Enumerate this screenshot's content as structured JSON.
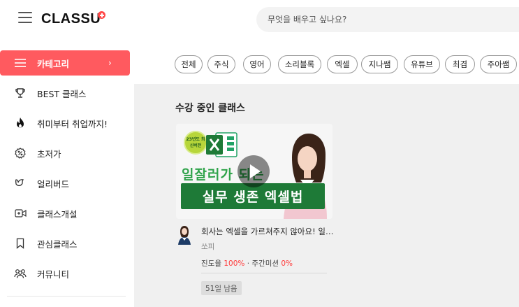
{
  "header": {
    "logo_text": "CLASSU",
    "search_placeholder": "무엇을 배우고 싶나요?"
  },
  "sidebar": {
    "items": [
      {
        "label": "카테고리",
        "icon": "menu-icon",
        "active": true
      },
      {
        "label": "BEST 클래스",
        "icon": "trophy-icon"
      },
      {
        "label": "취미부터 취업까지!",
        "icon": "fire-icon"
      },
      {
        "label": "초저가",
        "icon": "discount-badge-icon"
      },
      {
        "label": "얼리버드",
        "icon": "bird-icon"
      },
      {
        "label": "클래스개설",
        "icon": "video-plus-icon"
      },
      {
        "label": "관심클래스",
        "icon": "bookmark-icon"
      },
      {
        "label": "커뮤니티",
        "icon": "community-icon"
      }
    ]
  },
  "chips": [
    "전체",
    "주식",
    "영어",
    "소리블록",
    "엑셀",
    "지나쌤",
    "유튜브",
    "최겸",
    "주아쌤"
  ],
  "main": {
    "section_title": "수강 중인 클래스",
    "card": {
      "badge_text": "23년도 최신버전",
      "thumb_subtitle": "일잘러가 되는",
      "thumb_title": "실무 생존 엑셀법",
      "title": "회사는 엑셀을 가르쳐주지 않아요! 일잘러가 되는 실무 생존 엑셀법",
      "instructor": "쏘피",
      "progress_label": "진도율",
      "progress_value": "100%",
      "separator": "·",
      "mission_label": "주간미션",
      "mission_value": "0%",
      "days_left": "51일 남음"
    }
  },
  "colors": {
    "accent": "#ff5a5f",
    "excel_green": "#1e7a37",
    "highlight_red": "#ff3b3b"
  }
}
